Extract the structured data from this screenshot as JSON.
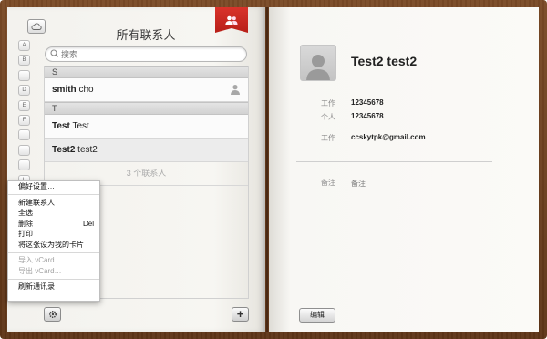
{
  "left_page": {
    "title": "所有联系人",
    "search_placeholder": "搜索",
    "alpha_index": [
      "A",
      "B",
      "",
      "D",
      "E",
      "F",
      "",
      "",
      "",
      "L",
      "M"
    ],
    "sections": [
      {
        "letter": "S",
        "contacts": [
          {
            "first": "smith",
            "last": "cho",
            "has_icon": true
          }
        ]
      },
      {
        "letter": "T",
        "contacts": [
          {
            "first": "Test",
            "last": "Test"
          },
          {
            "first": "Test2",
            "last": "test2",
            "selected": true
          }
        ]
      }
    ],
    "count_label": "3 个联系人",
    "add_label": "+"
  },
  "menu": {
    "preferences": "偏好设置…",
    "new_contact": "新建联系人",
    "select_all": "全选",
    "delete": "删除",
    "delete_shortcut": "Del",
    "print": "打印",
    "set_my_card": "将这张设为我的卡片",
    "import_vcard": "导入 vCard…",
    "export_vcard": "导出 vCard…",
    "refresh": "刷新通讯录"
  },
  "card": {
    "name": "Test2 test2",
    "fields": [
      {
        "label": "工作",
        "value": "12345678"
      },
      {
        "label": "个人",
        "value": "12345678"
      },
      {
        "label": "工作",
        "value": "ccskytpk@gmail.com"
      }
    ],
    "note_label": "备注",
    "note_value": "备注",
    "edit_label": "编辑"
  },
  "colors": {
    "ribbon": "#c9281f",
    "leather": "#6b3f1f",
    "page": "#f8f7f4"
  }
}
